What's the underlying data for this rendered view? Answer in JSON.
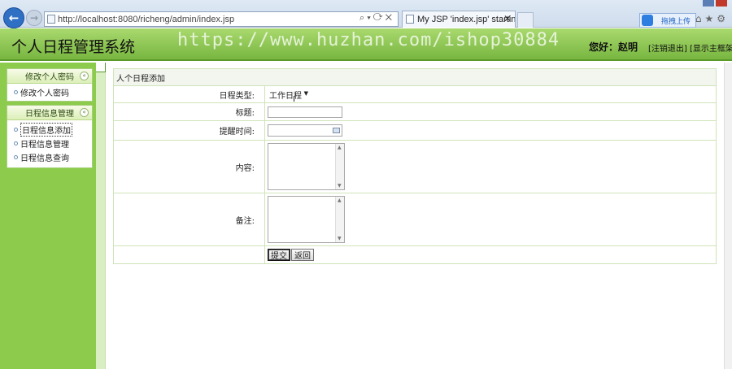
{
  "browser": {
    "url": "http://localhost:8080/richeng/admin/index.jsp",
    "address_tools": "⌕▾⟳✕",
    "tab_title": "My JSP 'index.jsp' startin...",
    "tab_close": "✕",
    "upload_label": "拖拽上传",
    "chrome_icons": "⌂★⚙",
    "back": "←",
    "forward": "→"
  },
  "header": {
    "title": "个人日程管理系统",
    "watermark": "https://www.huzhan.com/ishop30884",
    "greeting": "您好：赵明",
    "logout_link": "[注销退出]",
    "home_link": "[显示主框架]"
  },
  "sidebar": {
    "groups": [
      {
        "title": "修改个人密码",
        "collapse": "«",
        "items": [
          {
            "label": "修改个人密码"
          }
        ]
      },
      {
        "title": "日程信息管理",
        "collapse": "«",
        "items": [
          {
            "label": "日程信息添加"
          },
          {
            "label": "日程信息管理"
          },
          {
            "label": "日程信息查询"
          }
        ]
      }
    ]
  },
  "form": {
    "caption": "人个日程添加",
    "type_label": "日程类型:",
    "type_value": "工作日程",
    "title_label": "标题:",
    "remind_label": "提醒时间:",
    "content_label": "内容:",
    "note_label": "备注:",
    "submit_label": "提交",
    "back_label": "返回"
  },
  "colors": {
    "header_green": "#78b640",
    "sidebar_green": "#8ccb4c",
    "border_green": "#cfe3b8"
  }
}
